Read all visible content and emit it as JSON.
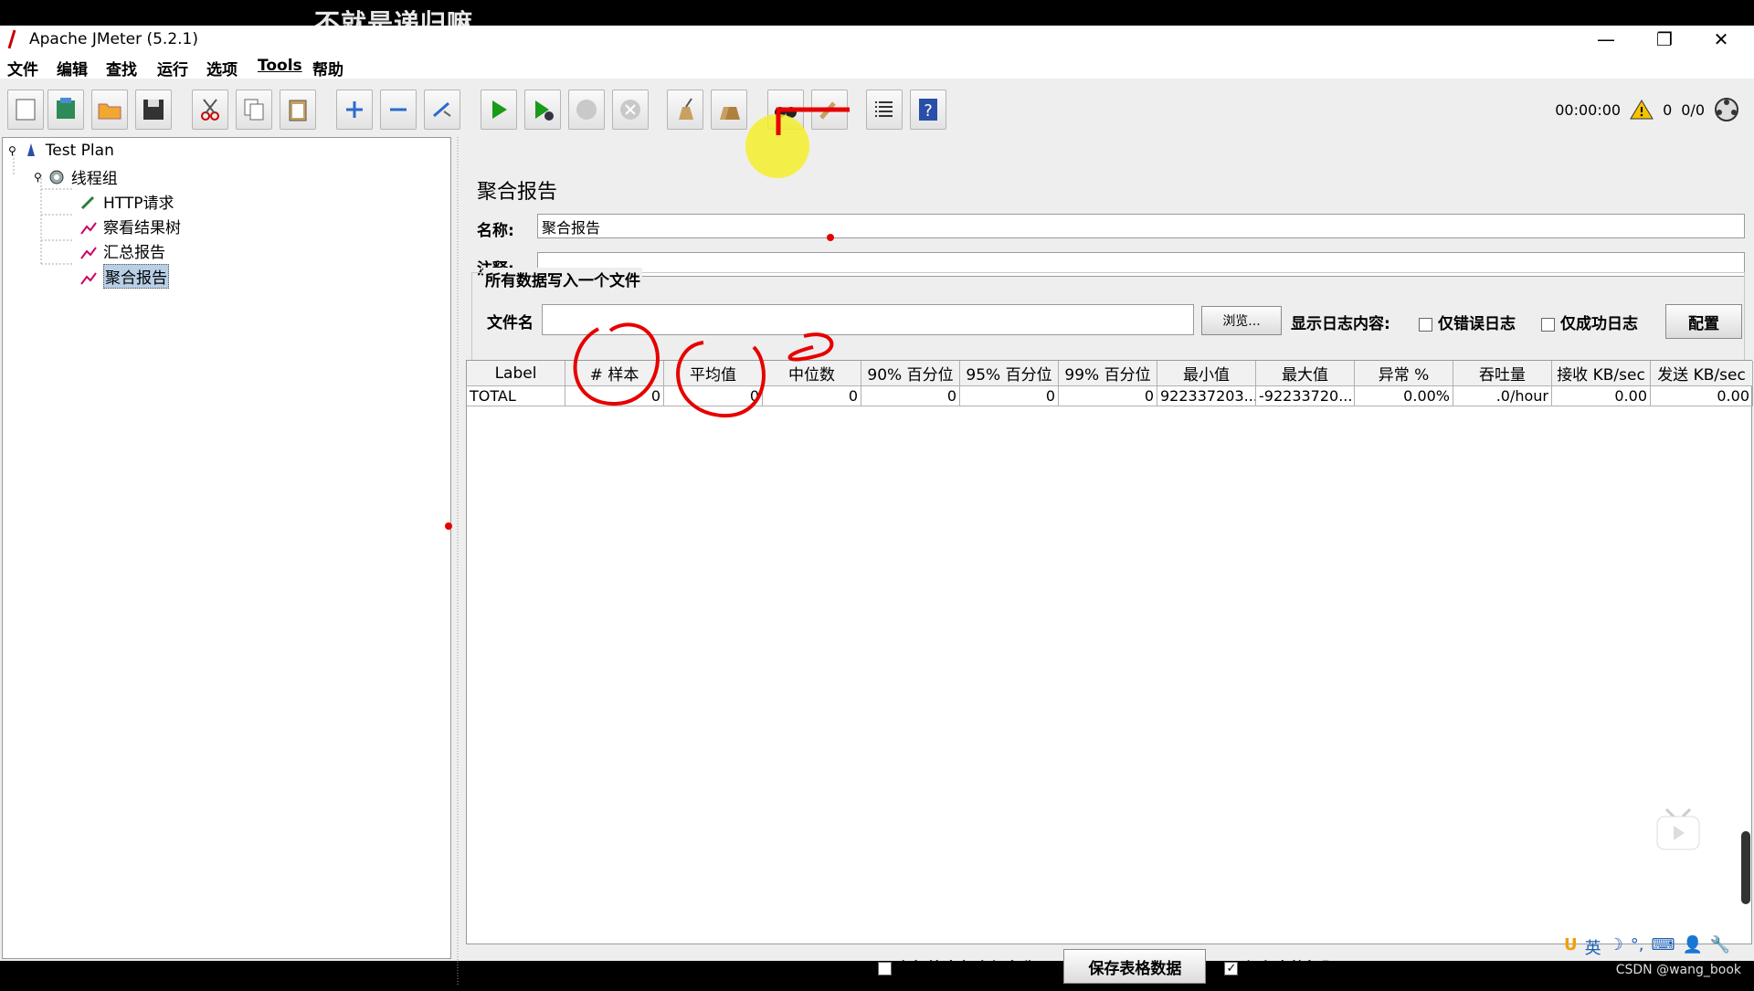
{
  "overlay_caption": "不就是递归嘛",
  "window": {
    "title": "Apache JMeter (5.2.1)"
  },
  "menu": [
    "文件",
    "编辑",
    "查找",
    "运行",
    "选项",
    "Tools",
    "帮助"
  ],
  "status": {
    "elapsed": "00:00:00",
    "warnings": "0",
    "threads": "0/0"
  },
  "tree": {
    "root": "Test Plan",
    "thread_group": "线程组",
    "children": [
      "HTTP请求",
      "察看结果树",
      "汇总报告",
      "聚合报告"
    ]
  },
  "panel": {
    "title": "聚合报告",
    "name_label": "名称:",
    "name_value": "聚合报告",
    "comment_label": "注释:",
    "comment_value": "",
    "group_title": "所有数据写入一个文件",
    "filename_label": "文件名",
    "filename_value": "",
    "browse_label": "浏览...",
    "log_label": "显示日志内容:",
    "errors_only_label": "仅错误日志",
    "success_only_label": "仅成功日志",
    "configure_label": "配置"
  },
  "table": {
    "headers": [
      "Label",
      "# 样本",
      "平均值",
      "中位数",
      "90% 百分位",
      "95% 百分位",
      "99% 百分位",
      "最小值",
      "最大值",
      "异常 %",
      "吞吐量",
      "接收 KB/sec",
      "发送 KB/sec"
    ],
    "rows": [
      [
        "TOTAL",
        "0",
        "0",
        "0",
        "0",
        "0",
        "0",
        "922337203...",
        "-92233720...",
        "0.00%",
        ".0/hour",
        "0.00",
        "0.00"
      ]
    ]
  },
  "bottom": {
    "include_group_label": "在标签中包含组名称?",
    "include_group_checked": false,
    "save_table_label": "保存表格数据",
    "save_header_label": "保存表格标题",
    "save_header_checked": true
  },
  "ime": [
    "U",
    "英",
    "☽",
    "°,",
    "⌨",
    "👤",
    "🔧"
  ],
  "watermark": "CSDN @wang_book",
  "colors": {
    "annotation_red": "#e60000",
    "highlight_yellow": "#f4ee2a",
    "selection_blue": "#b8cfe5"
  }
}
